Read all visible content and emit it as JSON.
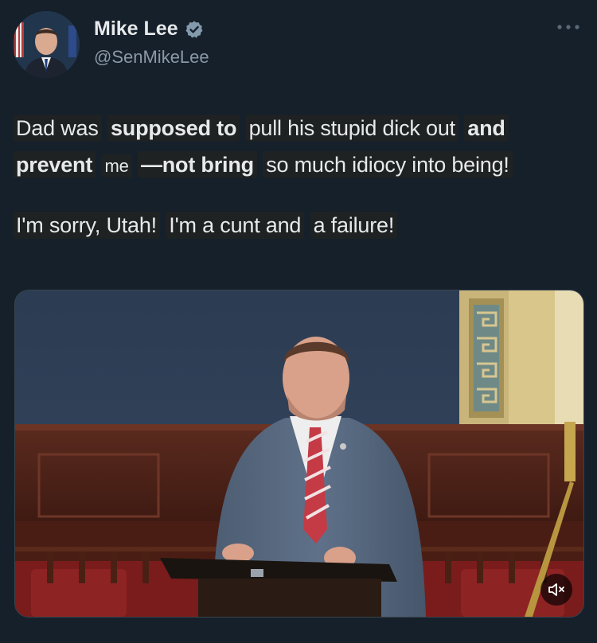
{
  "author": {
    "display_name": "Mike Lee",
    "handle": "@SenMikeLee",
    "verified_icon": "verified-badge-icon"
  },
  "more_icon": "more-horizontal-icon",
  "tweet_text": {
    "line1": {
      "a": "Dad was",
      "b": "supposed to",
      "c": "pull his stupid dick out",
      "d": "and"
    },
    "line2": {
      "a": "prevent",
      "b": "me",
      "c": "—not bring",
      "d": "so much idiocy into being!"
    },
    "line3": {
      "a": "I'm sorry, Utah!",
      "b": "I'm a cunt and",
      "c": "a failure!"
    }
  },
  "media": {
    "type": "video",
    "mute_icon": "volume-muted-icon"
  },
  "colors": {
    "background": "#15202b",
    "text": "#e7e9ea",
    "secondary_text": "#8b98a5",
    "verified_badge": "#829aab"
  }
}
